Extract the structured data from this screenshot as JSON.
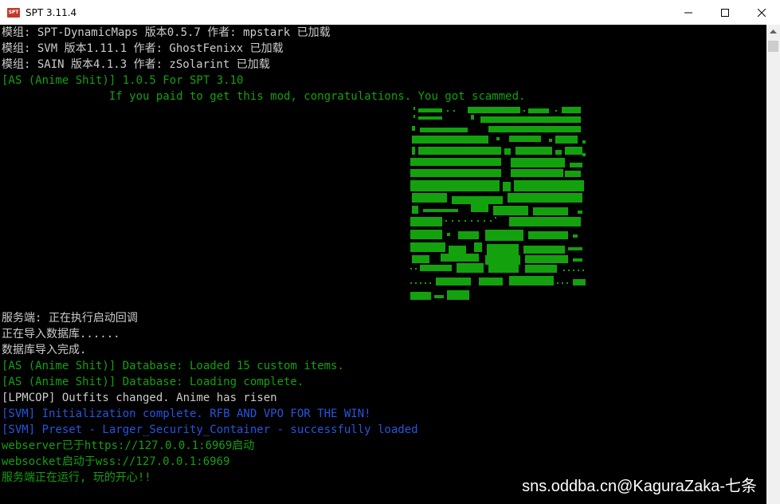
{
  "window": {
    "title": "SPT 3.11.4",
    "app_icon_text": "SPT",
    "controls": [
      "minimize-icon",
      "maximize-icon",
      "close-icon"
    ]
  },
  "colors": {
    "background": "#000000",
    "text_default": "#cccccc",
    "text_green": "#13a10e",
    "text_blue": "#2456e0"
  },
  "console": {
    "lines": [
      {
        "text": "模组: SPT-DynamicMaps 版本0.5.7 作者: mpstark 已加载",
        "color": "white"
      },
      {
        "text": "模组: SVM 版本1.11.1 作者: GhostFenixx 已加载",
        "color": "white"
      },
      {
        "text": "模组: SAIN 版本4.1.3 作者: zSolarint 已加载",
        "color": "white"
      },
      {
        "text": "[AS (Anime Shit)] 1.0.5 For SPT 3.10",
        "color": "green"
      },
      {
        "text": "                If you paid to get this mod, congratulations. You got scammed.",
        "color": "green"
      },
      {
        "text": "服务端: 正在执行启动回调",
        "color": "white"
      },
      {
        "text": "正在导入数据库......",
        "color": "white"
      },
      {
        "text": "数据库导入完成.",
        "color": "white"
      },
      {
        "text": "[AS (Anime Shit)] Database: Loaded 15 custom items.",
        "color": "green"
      },
      {
        "text": "[AS (Anime Shit)] Database: Loading complete.",
        "color": "green"
      },
      {
        "text": "[LPMCOP] Outfits changed. Anime has risen",
        "color": "white"
      },
      {
        "text": "[SVM] Initialization complete. RFB AND VPO FOR THE WIN!",
        "color": "blue"
      },
      {
        "text": "[SVM] Preset - Larger_Security_Container - successfully loaded",
        "color": "blue"
      },
      {
        "text": "webserver已于https://127.0.0.1:6969启动",
        "color": "green"
      },
      {
        "text": "websocket启动于wss://127.0.0.1:6969",
        "color": "green"
      },
      {
        "text": "服务端正在运行, 玩的开心!!",
        "color": "green"
      }
    ],
    "ascii_art": "anime-character-ascii-art"
  },
  "watermark": "sns.oddba.cn@KaguraZaka-七条"
}
